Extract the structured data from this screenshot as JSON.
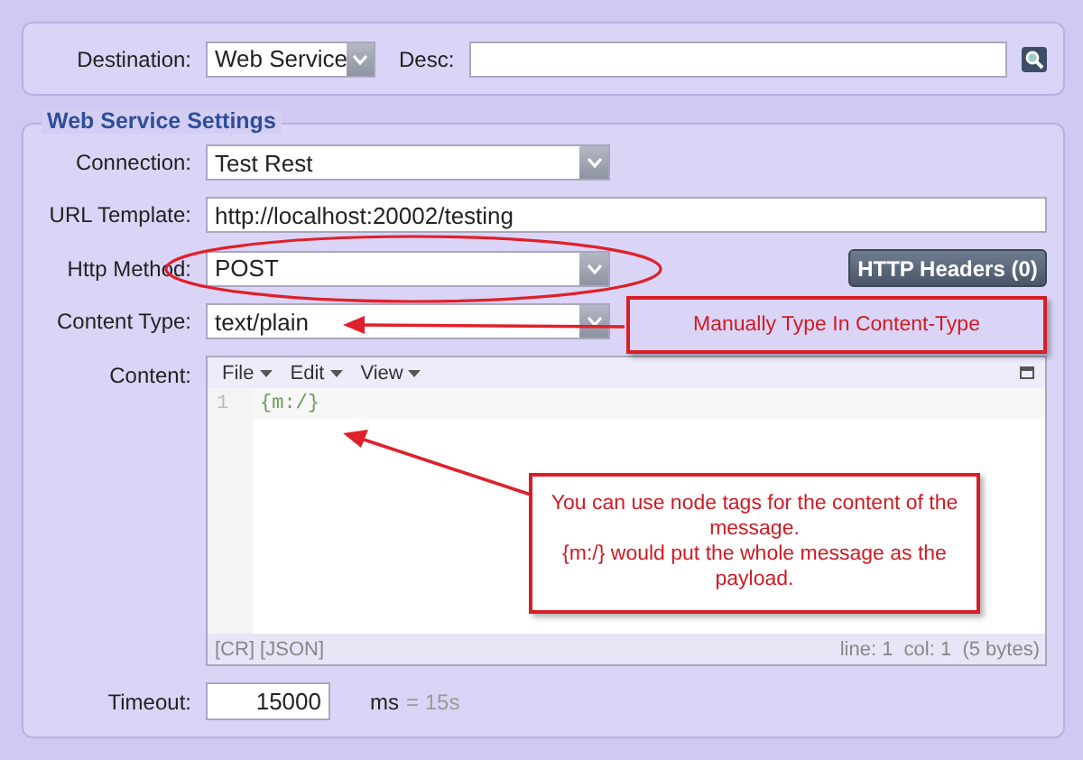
{
  "destination": {
    "label": "Destination:",
    "value": "Web Service",
    "desc_label": "Desc:"
  },
  "settings": {
    "title": "Web Service Settings",
    "rows": [
      {
        "kind": "select",
        "label": "Connection:",
        "value": "Test Rest"
      },
      {
        "kind": "text",
        "label": "URL Template:",
        "value": "http://localhost:20002/testing"
      },
      {
        "kind": "select",
        "label": "Http Method:",
        "value": "POST",
        "button": "HTTP Headers (0)"
      },
      {
        "kind": "select",
        "label": "Content Type:",
        "value": "text/plain"
      }
    ],
    "content": {
      "label": "Content:",
      "menus": [
        "File",
        "Edit",
        "View"
      ],
      "line_number": "1",
      "code": "{m:/}",
      "status_left": "[CR] [JSON]",
      "status_right": "line: 1  col: 1  (5 bytes)"
    },
    "timeout": {
      "label": "Timeout:",
      "value": "15000",
      "unit": "ms",
      "equivalent": "= 15s"
    }
  },
  "annotations": [
    {
      "kind": "box",
      "text": "Manually Type In Content-Type"
    },
    {
      "kind": "box",
      "text": "You can use node tags for the content of the message.\n{m:/} would put the whole message as the payload."
    }
  ]
}
